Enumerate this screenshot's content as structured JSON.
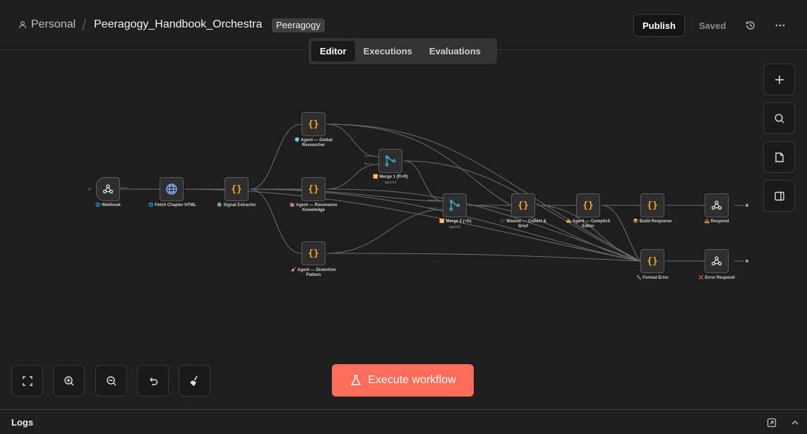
{
  "header": {
    "breadcrumb_personal": "Personal",
    "breadcrumb_separator": "/",
    "workflow_name": "Peeragogy_Handbook_Orchestra",
    "tag": "Peeragogy",
    "publish_label": "Publish",
    "saved_label": "Saved"
  },
  "tabs": [
    {
      "label": "Editor",
      "active": true
    },
    {
      "label": "Executions",
      "active": false
    },
    {
      "label": "Evaluations",
      "active": false
    }
  ],
  "nodes": {
    "webhook": {
      "label": "🌐 Webhook",
      "icon": "webhook-icon",
      "port_label": "POST"
    },
    "fetch": {
      "label": "🌐 Fetch Chapter HTML",
      "icon": "globe-icon"
    },
    "signal": {
      "label": "⚙️ Signal Extractor",
      "icon": "code-icon"
    },
    "global": {
      "label": "🌍 Agent — Global Researcher",
      "icon": "code-icon"
    },
    "resonance": {
      "label": "📚 Agent — Resonance Knowledge",
      "icon": "code-icon"
    },
    "distortion": {
      "label": "🎸 Agent — Distortion Pattern",
      "icon": "code-icon"
    },
    "merge1": {
      "label": "🔀 Merge 1 (R+R)",
      "sub": "append",
      "icon": "merge-icon",
      "in1": "Input 1",
      "in2": "Input 2"
    },
    "merge2": {
      "label": "🔀 Merge 2 (+D)",
      "sub": "append",
      "icon": "merge-icon",
      "in1": "Input 1",
      "in2": "Input 2"
    },
    "weaver": {
      "label": "🕸️ Weaver — Collect & Brief",
      "icon": "code-icon"
    },
    "complicit": {
      "label": "✍️ Agent — Complicit Editor",
      "icon": "code-icon"
    },
    "build": {
      "label": "📦 Build Response",
      "icon": "code-icon"
    },
    "respond": {
      "label": "📤 Respond",
      "icon": "webhook-icon"
    },
    "format_error": {
      "label": "🔧 Format Error",
      "icon": "code-icon"
    },
    "error_respond": {
      "label": "❌ Error Respond",
      "icon": "webhook-icon"
    }
  },
  "code_glyph": "{}",
  "controls": {
    "execute_label": "Execute workflow",
    "fit_view": "fit-view-icon",
    "zoom_in": "zoom-in-icon",
    "zoom_out": "zoom-out-icon",
    "undo": "undo-icon",
    "clean": "broom-icon"
  },
  "side_tools": [
    "plus-icon",
    "search-icon",
    "sticky-note-icon",
    "panel-icon"
  ],
  "logs": {
    "title": "Logs"
  },
  "colors": {
    "accent": "#ff6d5a",
    "code": "#f5a623",
    "merge": "#3fb6d8",
    "background": "#1e1e1e"
  }
}
